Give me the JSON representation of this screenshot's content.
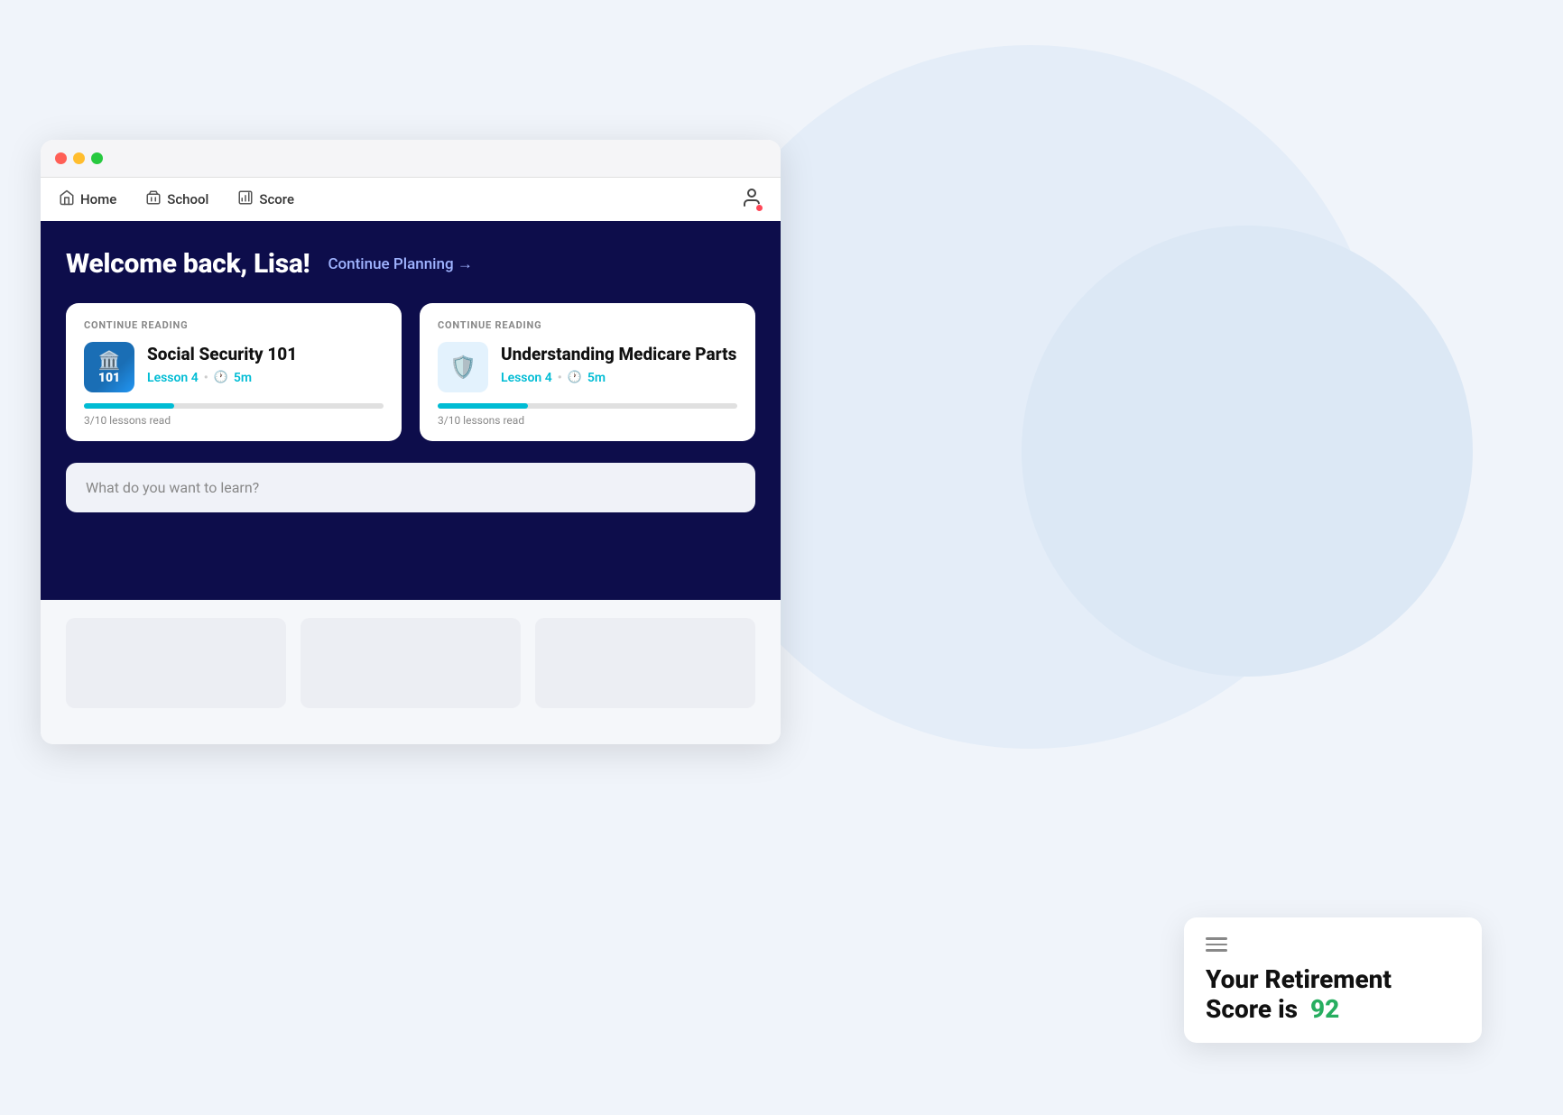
{
  "background": {
    "color": "#f0f4fa"
  },
  "browser": {
    "window_controls": {
      "close_label": "close",
      "minimize_label": "minimize",
      "maximize_label": "maximize"
    }
  },
  "nav": {
    "home_label": "Home",
    "school_label": "School",
    "score_label": "Score",
    "user_icon_label": "user profile"
  },
  "main": {
    "welcome_text": "Welcome back, Lisa!",
    "continue_planning": "Continue Planning →",
    "card1": {
      "section_label": "CONTINUE READING",
      "title": "Social Security 101",
      "lesson": "Lesson 4",
      "duration": "5m",
      "progress_text": "3/10 lessons read",
      "progress_pct": 30
    },
    "card2": {
      "section_label": "CONTINUE READING",
      "title": "Understanding Medicare Parts",
      "lesson": "Lesson 4",
      "duration": "5m",
      "progress_text": "3/10 lessons read",
      "progress_pct": 30
    },
    "search_placeholder": "What do you want to learn?"
  },
  "retirement_card": {
    "title_line1": "Your Retirement",
    "title_line2": "Score is",
    "score": "92",
    "score_color": "#27ae60"
  }
}
